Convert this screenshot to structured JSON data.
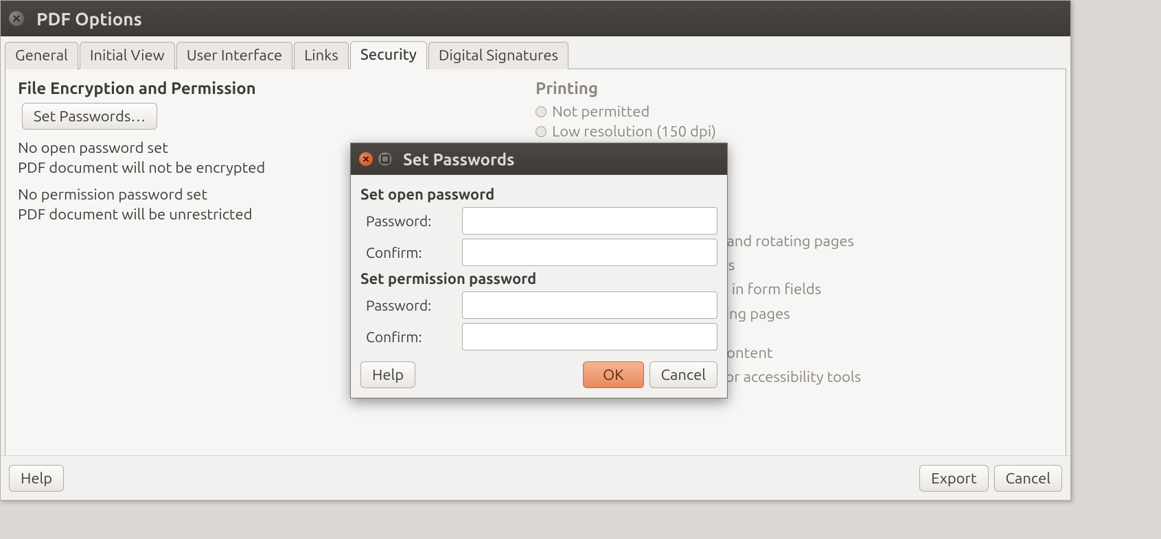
{
  "window": {
    "title": "PDF Options",
    "tabs": [
      {
        "label": "General"
      },
      {
        "label": "Initial View"
      },
      {
        "label": "User Interface"
      },
      {
        "label": "Links"
      },
      {
        "label": "Security",
        "active": true
      },
      {
        "label": "Digital Signatures"
      }
    ],
    "footer": {
      "help": "Help",
      "export": "Export",
      "cancel": "Cancel"
    }
  },
  "security": {
    "left": {
      "heading": "File Encryption and Permission",
      "set_passwords_button": "Set Passwords…",
      "open_status1": "No open password set",
      "open_status2": "PDF document will not be encrypted",
      "perm_status1": "No permission password set",
      "perm_status2": "PDF document will be unrestricted"
    },
    "right": {
      "printing_heading": "Printing",
      "printing_not_permitted": "Not permitted",
      "printing_low_res_fragment": "Low resolution (150 dpi)",
      "frag_rotating": ", and rotating pages",
      "frag_ds": "ds",
      "frag_form": "g in form fields",
      "frag_ting_pages": "ting pages",
      "frag_content": "content",
      "frag_accessibility": "for accessibility tools"
    }
  },
  "modal": {
    "title": "Set Passwords",
    "open_heading": "Set open password",
    "perm_heading": "Set permission password",
    "password_label": "Password:",
    "confirm_label": "Confirm:",
    "open_password_value": "",
    "open_confirm_value": "",
    "perm_password_value": "",
    "perm_confirm_value": "",
    "help": "Help",
    "ok": "OK",
    "cancel": "Cancel"
  }
}
